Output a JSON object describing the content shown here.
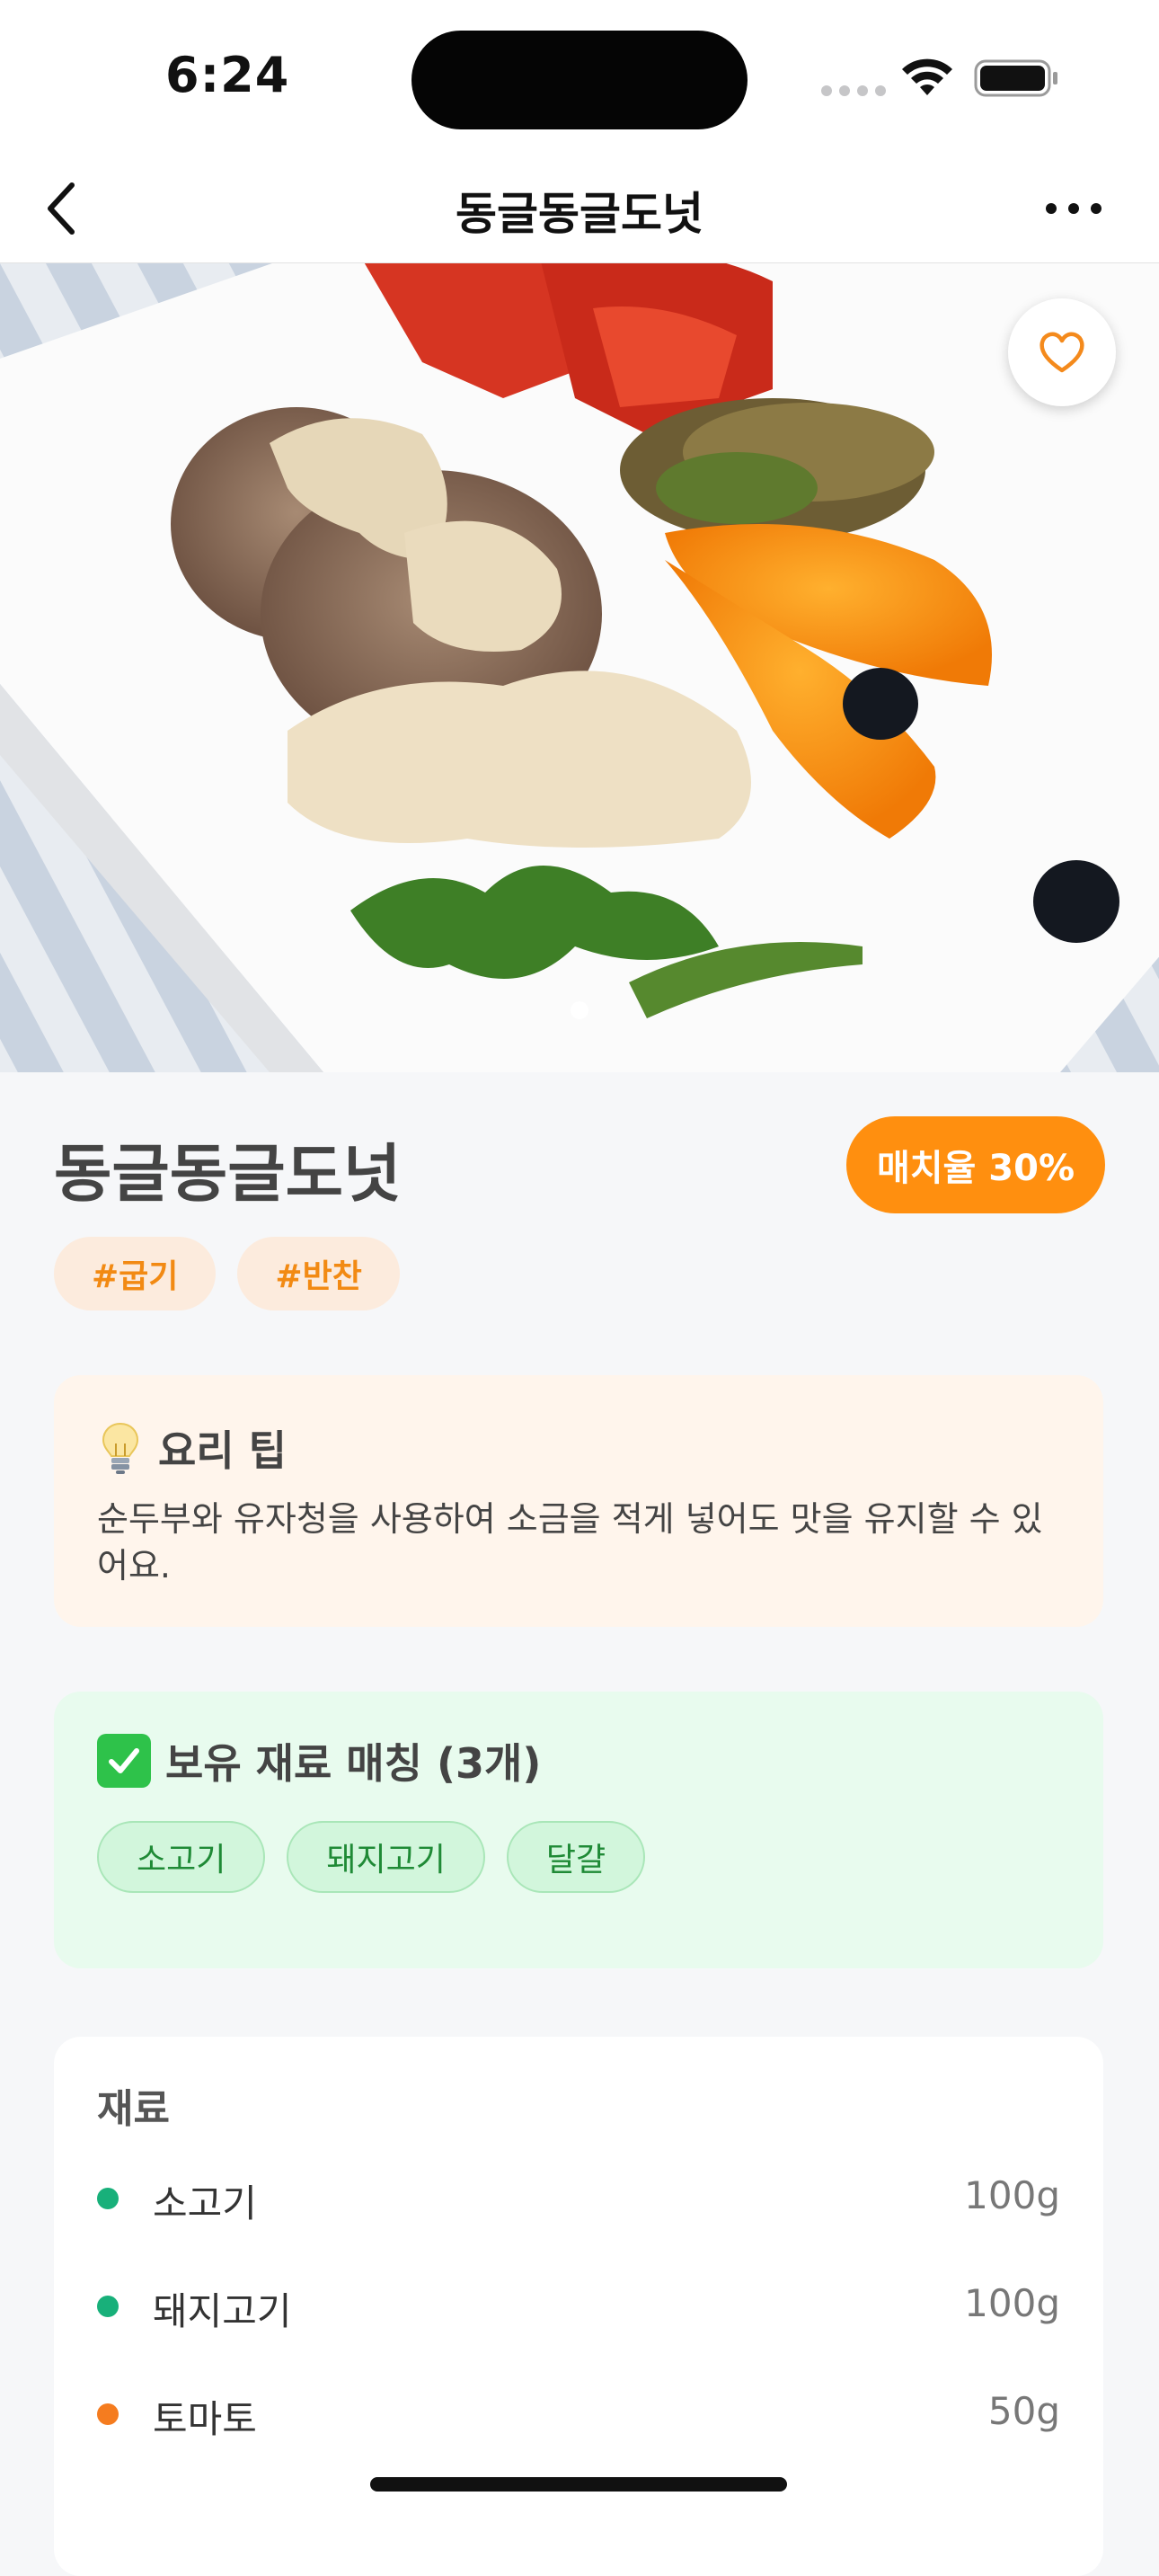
{
  "status_bar": {
    "time": "6:24"
  },
  "nav": {
    "title": "동글동글도넛",
    "back_icon": "chevron-left-icon",
    "more_icon": "ellipsis-icon"
  },
  "hero": {
    "favorite_icon": "heart-outline-icon",
    "page_count": 1,
    "current_page": 1
  },
  "recipe": {
    "title": "동글동글도넛",
    "match_label": "매치율 30%",
    "tags": [
      "#굽기",
      "#반찬"
    ]
  },
  "tip": {
    "icon": "lightbulb-icon",
    "title": "요리 팁",
    "body": "순두부와 유자청을 사용하여 소금을 적게 넣어도 맛을 유지할 수 있어요."
  },
  "matched": {
    "icon": "check-box-icon",
    "title": "보유 재료 매칭 (3개)",
    "items": [
      "소고기",
      "돼지고기",
      "달걀"
    ]
  },
  "ingredients": {
    "title": "재료",
    "items": [
      {
        "name": "소고기",
        "amount": "100g",
        "status": "owned"
      },
      {
        "name": "돼지고기",
        "amount": "100g",
        "status": "owned"
      },
      {
        "name": "토마토",
        "amount": "50g",
        "status": "missing"
      }
    ]
  },
  "colors": {
    "accent": "#ff8f0f",
    "owned_dot": "#18b07a",
    "missing_dot": "#f57c1f",
    "match_green": "#2ec24a"
  }
}
